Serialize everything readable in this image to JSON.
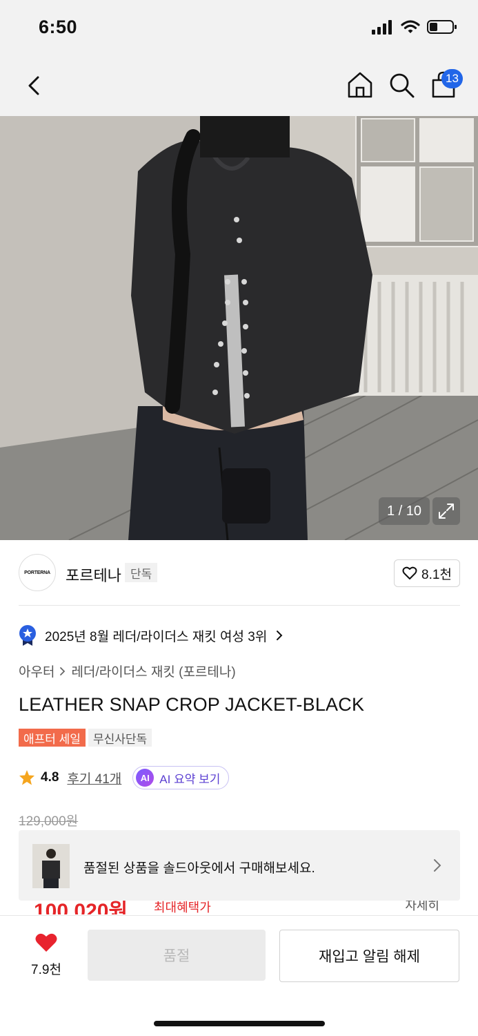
{
  "status": {
    "time": "6:50"
  },
  "header": {
    "cart_count": "13"
  },
  "gallery": {
    "counter": "1 / 10"
  },
  "brand": {
    "logo_text": "PORTERNA",
    "name": "포르테나",
    "tag": "단독",
    "likes": "8.1천"
  },
  "ranking": {
    "text": "2025년 8월 레더/라이더스 재킷 여성 3위"
  },
  "breadcrumb": {
    "category": "아우터",
    "subcategory": "레더/라이더스 재킷 (포르테나)"
  },
  "product": {
    "title": "LEATHER SNAP CROP JACKET-BLACK",
    "tags": [
      "애프터 세일",
      "무신사단독"
    ],
    "rating": "4.8",
    "reviews": "후기 41개",
    "ai_label": "AI",
    "ai_summary": "AI 요약 보기",
    "original_price": "129,000원",
    "sale_price": "100,020원",
    "benefit_label": "최대혜택가",
    "detail_label": "자세히"
  },
  "soldout_banner": {
    "text": "품절된 상품을 솔드아웃에서 구매해보세요."
  },
  "bottom": {
    "wish_count": "7.9천",
    "soldout_label": "품절",
    "restock_label": "재입고 알림 해제"
  },
  "colors": {
    "accent_blue": "#2266e8",
    "sale_red": "#e52528",
    "tag_orange": "#f26b4b",
    "heart_red": "#e8232e"
  }
}
